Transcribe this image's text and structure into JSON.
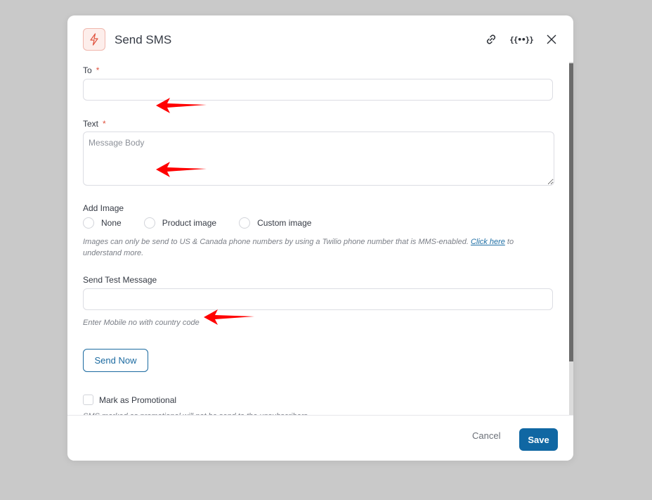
{
  "modal": {
    "title": "Send SMS",
    "header_icons": [
      "lightning-icon",
      "link-icon",
      "merge-tags-icon",
      "close-icon"
    ]
  },
  "form": {
    "to": {
      "label": "To",
      "required_mark": "*",
      "value": "",
      "placeholder": ""
    },
    "text": {
      "label": "Text",
      "required_mark": "*",
      "value": "",
      "placeholder": "Message Body"
    },
    "add_image": {
      "label": "Add Image",
      "options": [
        "None",
        "Product image",
        "Custom image"
      ],
      "selected": null,
      "hint_before": "Images can only be send to US & Canada phone numbers by using a Twilio phone number that is MMS-enabled. ",
      "hint_link": "Click here",
      "hint_after": " to understand more."
    },
    "test_message": {
      "label": "Send Test Message",
      "value": "",
      "placeholder": "",
      "hint": "Enter Mobile no with country code",
      "button": "Send Now"
    },
    "promotional": {
      "label": "Mark as Promotional",
      "checked": false,
      "hint": "SMS marked as promotional will not be send to the unsubscribers"
    }
  },
  "footer": {
    "cancel": "Cancel",
    "save": "Save"
  },
  "colors": {
    "accent": "#1067a3",
    "required": "#e0533f",
    "annotation_arrow": "#ff0000"
  }
}
